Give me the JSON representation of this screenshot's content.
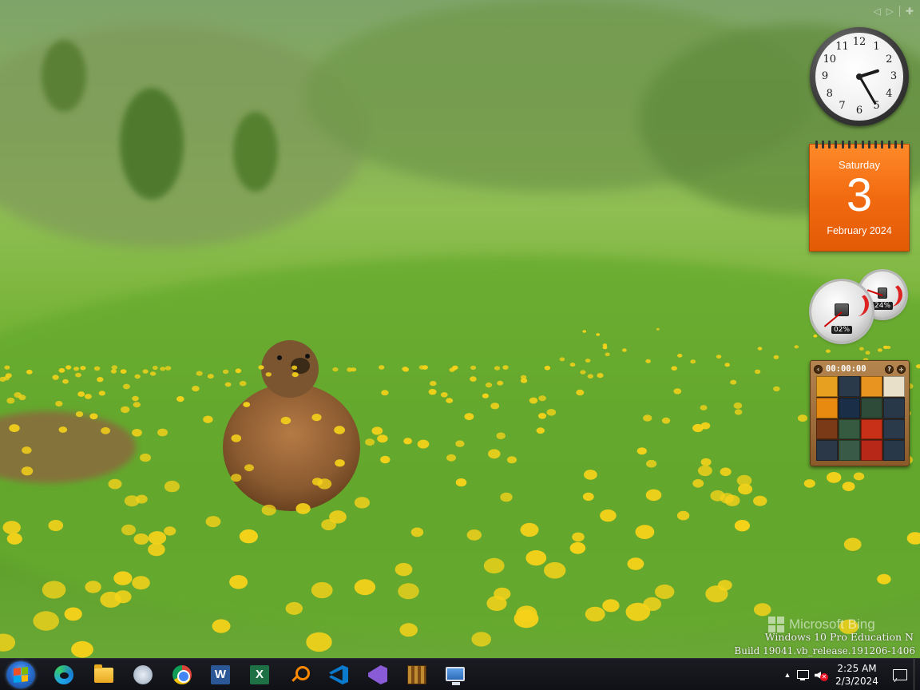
{
  "desktop": {
    "watermark_brand": "Microsoft Bing",
    "os_edition": "Windows 10 Pro Education N",
    "os_build": "Build 19041.vb_release.191206-1406"
  },
  "gadget_controls": {
    "prev_icon": "chevron-left-icon",
    "next_icon": "chevron-right-icon",
    "add_icon": "plus-icon",
    "prev_glyph": "◁",
    "next_glyph": "▷",
    "add_glyph": "✚"
  },
  "clock": {
    "numerals": [
      "12",
      "1",
      "2",
      "3",
      "4",
      "5",
      "6",
      "7",
      "8",
      "9",
      "10",
      "11"
    ],
    "hour": 2,
    "minute": 25
  },
  "calendar": {
    "weekday": "Saturday",
    "day": "3",
    "month_year": "February 2024",
    "accent": "#f26a10"
  },
  "cpu_meter": {
    "cpu_percent": "02%",
    "memory_percent": "24%",
    "cpu_value": 2,
    "memory_value": 24
  },
  "puzzle": {
    "timer": "00:00:00",
    "back_icon": "back-arrow-icon",
    "help_icon": "help-icon",
    "solve_icon": "solve-icon",
    "tiles": [
      "#e8a020",
      "#2b3a4a",
      "#e89420",
      "#e8e0c8",
      "#e88a10",
      "#1a2e48",
      "#2e4a38",
      "#283848",
      "#7a3a18",
      "#355a40",
      "#c83018",
      "#2a3a4a",
      "#2a3848",
      "#3a5a48",
      "#b82818",
      "#283848"
    ]
  },
  "taskbar": {
    "apps": [
      {
        "name": "edge-icon",
        "label": "Microsoft Edge"
      },
      {
        "name": "file-explorer-icon",
        "label": "File Explorer"
      },
      {
        "name": "steam-icon",
        "label": "Steam"
      },
      {
        "name": "chrome-icon",
        "label": "Google Chrome"
      },
      {
        "name": "word-icon",
        "label": "Word",
        "glyph": "W"
      },
      {
        "name": "excel-icon",
        "label": "Excel",
        "glyph": "X"
      },
      {
        "name": "search-tool-icon",
        "label": "Search"
      },
      {
        "name": "vscode-icon",
        "label": "Visual Studio Code"
      },
      {
        "name": "visual-studio-icon",
        "label": "Visual Studio"
      },
      {
        "name": "game-icon",
        "label": "Game"
      },
      {
        "name": "remote-desktop-icon",
        "label": "Remote Desktop"
      }
    ],
    "tray": {
      "chevron": "▲",
      "time": "2:25 AM",
      "date": "2/3/2024"
    }
  }
}
